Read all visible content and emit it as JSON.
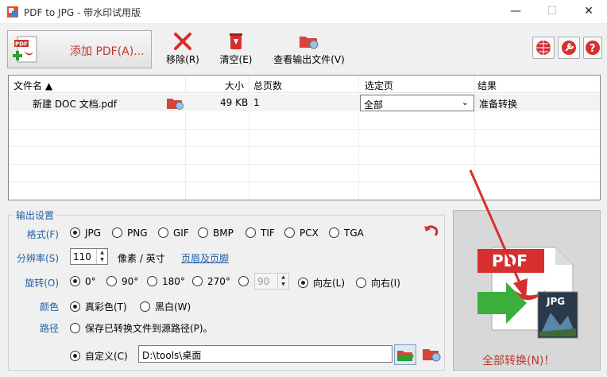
{
  "window": {
    "title": "PDF to JPG - 带水印试用版",
    "minimize": "—",
    "maximize": "☐",
    "close": "✕"
  },
  "toolbar": {
    "add_pdf": "添加 PDF(A)...",
    "remove": "移除(R)",
    "clear": "清空(E)",
    "view_output": "查看输出文件(V)"
  },
  "table": {
    "headers": [
      "文件名 ▲",
      "大小",
      "总页数",
      "选定页",
      "结果"
    ],
    "rows": [
      {
        "filename": "新建 DOC 文档.pdf",
        "size": "49 KB",
        "pages": "1",
        "selected_pages": "全部",
        "result": "准备转换"
      }
    ]
  },
  "settings": {
    "group_title": "输出设置",
    "format_label": "格式(F)",
    "formats": [
      "JPG",
      "PNG",
      "GIF",
      "BMP",
      "TIF",
      "PCX",
      "TGA"
    ],
    "selected_format": "JPG",
    "resolution_label": "分辨率(S)",
    "resolution_value": "110",
    "resolution_unit": "像素 / 英寸",
    "header_footer_link": "页眉及页脚",
    "rotation_label": "旋转(O)",
    "rotations": [
      "0°",
      "90°",
      "180°",
      "270°",
      "°"
    ],
    "selected_rotation": "0°",
    "rotation_custom_value": "90",
    "rotate_left": "向左(L)",
    "rotate_right": "向右(I)",
    "color_label": "颜色",
    "color_true": "真彩色(T)",
    "color_bw": "黑白(W)",
    "path_label": "路径",
    "path_source": "保存已转换文件到源路径(P)。",
    "path_custom": "自定义(C)",
    "path_value": "D:\\tools\\桌面"
  },
  "convert": {
    "label": "全部转换(N)！",
    "pdf_text": "PDF",
    "jpg_text": "JPG"
  },
  "colors": {
    "accent_red": "#c0392b",
    "label_blue": "#1f5fa8"
  }
}
